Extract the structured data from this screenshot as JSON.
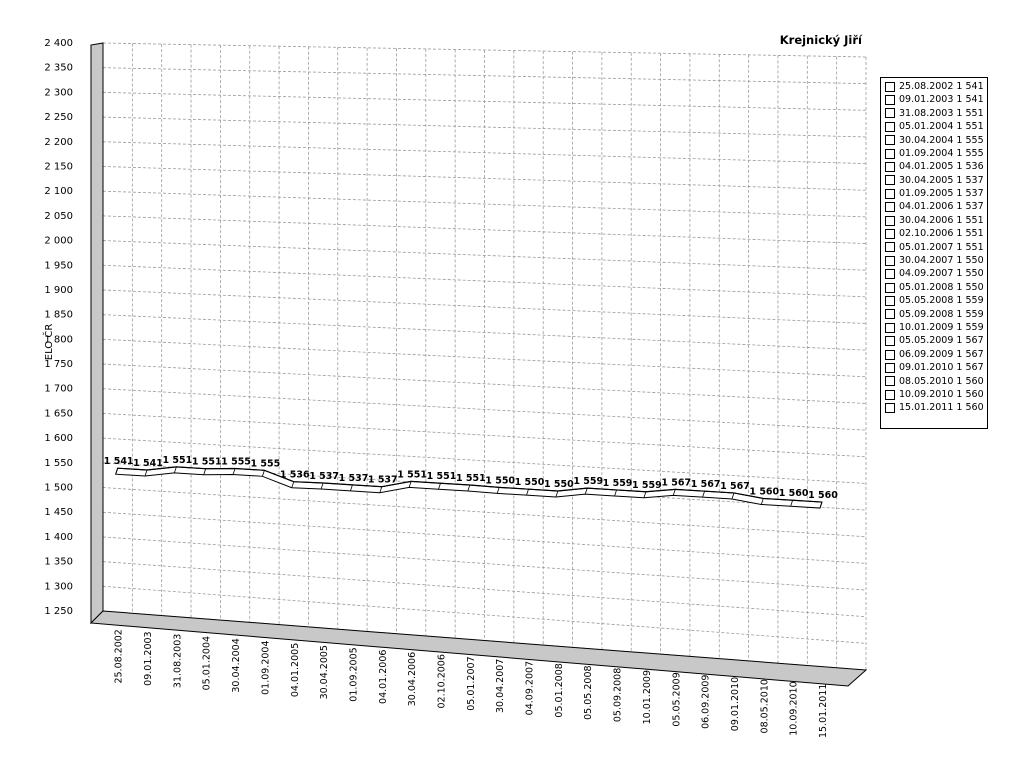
{
  "chart_data": {
    "type": "line",
    "title": "Krejnický Jiří",
    "xlabel": "",
    "ylabel": "ELO ČR",
    "ylim": [
      1250,
      2400
    ],
    "y_tick_step": 50,
    "y_ticks": [
      "2 400",
      "2 350",
      "2 300",
      "2 250",
      "2 200",
      "2 150",
      "2 100",
      "2 050",
      "2 000",
      "1 950",
      "1 900",
      "1 850",
      "1 800",
      "1 750",
      "1 700",
      "1 650",
      "1 600",
      "1 550",
      "1 500",
      "1 450",
      "1 400",
      "1 350",
      "1 300",
      "1 250"
    ],
    "grid": true,
    "legend_position": "right",
    "three_d": true,
    "categories": [
      "25.08.2002",
      "09.01.2003",
      "31.08.2003",
      "05.01.2004",
      "30.04.2004",
      "01.09.2004",
      "04.01.2005",
      "30.04.2005",
      "01.09.2005",
      "04.01.2006",
      "30.04.2006",
      "02.10.2006",
      "05.01.2007",
      "30.04.2007",
      "04.09.2007",
      "05.01.2008",
      "05.05.2008",
      "05.09.2008",
      "10.01.2009",
      "05.05.2009",
      "06.09.2009",
      "09.01.2010",
      "08.05.2010",
      "10.09.2010",
      "15.01.2011"
    ],
    "series": [
      {
        "values": [
          1541,
          1541,
          1551,
          1551,
          1555,
          1555,
          1536,
          1537,
          1537,
          1537,
          1551,
          1551,
          1551,
          1550,
          1550,
          1550,
          1559,
          1559,
          1559,
          1567,
          1567,
          1567,
          1560,
          1560,
          1560
        ],
        "data_labels": [
          "1 541",
          "1 541",
          "1 551",
          "1 551",
          "1 555",
          "1 555",
          "1 536",
          "1 537",
          "1 537",
          "1 537",
          "1 551",
          "1 551",
          "1 551",
          "1 550",
          "1 550",
          "1 550",
          "1 559",
          "1 559",
          "1 559",
          "1 567",
          "1 567",
          "1 567",
          "1 560",
          "1 560",
          "1 560"
        ]
      }
    ],
    "legend": [
      "25.08.2002 1 541",
      "09.01.2003 1 541",
      "31.08.2003 1 551",
      "05.01.2004 1 551",
      "30.04.2004 1 555",
      "01.09.2004 1 555",
      "04.01.2005 1 536",
      "30.04.2005 1 537",
      "01.09.2005 1 537",
      "04.01.2006 1 537",
      "30.04.2006 1 551",
      "02.10.2006 1 551",
      "05.01.2007 1 551",
      "30.04.2007 1 550",
      "04.09.2007 1 550",
      "05.01.2008 1 550",
      "05.05.2008 1 559",
      "05.09.2008 1 559",
      "10.01.2009 1 559",
      "05.05.2009 1 567",
      "06.09.2009 1 567",
      "09.01.2010 1 567",
      "08.05.2010 1 560",
      "10.09.2010 1 560",
      "15.01.2011 1 560"
    ]
  }
}
